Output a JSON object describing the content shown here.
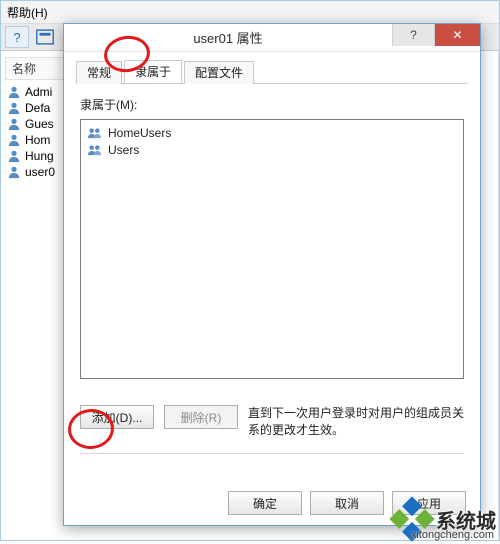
{
  "bg": {
    "menu_help": "帮助(H)",
    "list_header": "名称",
    "users": [
      "Admi",
      "Defa",
      "Gues",
      "Hom",
      "Hung",
      "user0"
    ]
  },
  "dialog": {
    "title": "user01 属性",
    "help_btn": "?",
    "close_btn": "✕",
    "tabs": {
      "general": "常规",
      "memberof": "隶属于",
      "profile": "配置文件"
    },
    "member_label": "隶属于(M):",
    "groups": [
      "HomeUsers",
      "Users"
    ],
    "add_btn": "添加(D)...",
    "remove_btn": "删除(R)",
    "note": "直到下一次用户登录时对用户的组成员关系的更改才生效。",
    "ok_btn": "确定",
    "cancel_btn": "取消",
    "apply_btn": "应用"
  },
  "watermark": {
    "text": "系统城",
    "url": "xitongcheng.com"
  }
}
